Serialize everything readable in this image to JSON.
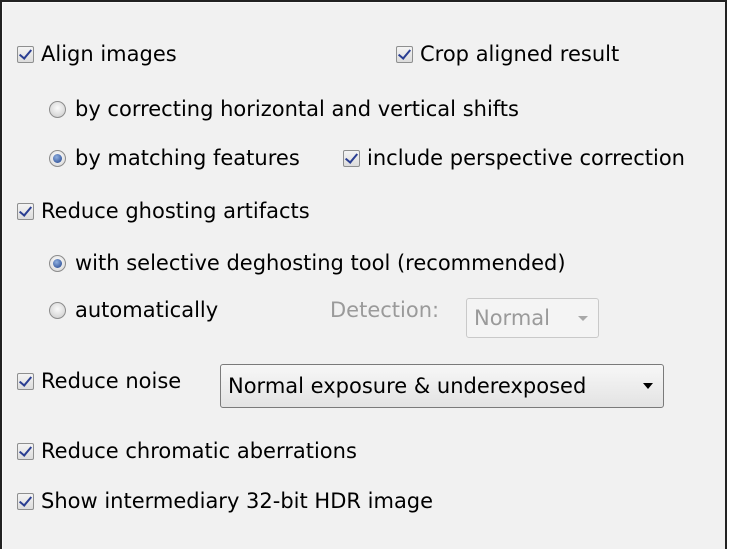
{
  "options": {
    "align_images": {
      "label": "Align images",
      "checked": true
    },
    "crop_aligned": {
      "label": "Crop aligned result",
      "checked": true
    },
    "align_method": {
      "shifts": {
        "label": "by correcting horizontal and vertical shifts",
        "selected": false
      },
      "features": {
        "label": "by matching features",
        "selected": true
      }
    },
    "perspective": {
      "label": "include perspective correction",
      "checked": true
    },
    "reduce_ghosting": {
      "label": "Reduce ghosting artifacts",
      "checked": true
    },
    "ghost_method": {
      "selective": {
        "label": "with selective deghosting tool (recommended)",
        "selected": true
      },
      "automatic": {
        "label": "automatically",
        "selected": false
      }
    },
    "detection": {
      "label": "Detection:",
      "value": "Normal",
      "enabled": false
    },
    "reduce_noise": {
      "label": "Reduce noise",
      "checked": true
    },
    "noise_mode": {
      "value": "Normal exposure & underexposed"
    },
    "reduce_chromatic": {
      "label": "Reduce chromatic aberrations",
      "checked": true
    },
    "show_hdr": {
      "label": "Show intermediary 32-bit HDR image",
      "checked": true
    }
  },
  "colors": {
    "panel_bg": "#f1f1f1",
    "check_mark": "#2a3e92",
    "disabled_text": "#9a9a9a"
  }
}
